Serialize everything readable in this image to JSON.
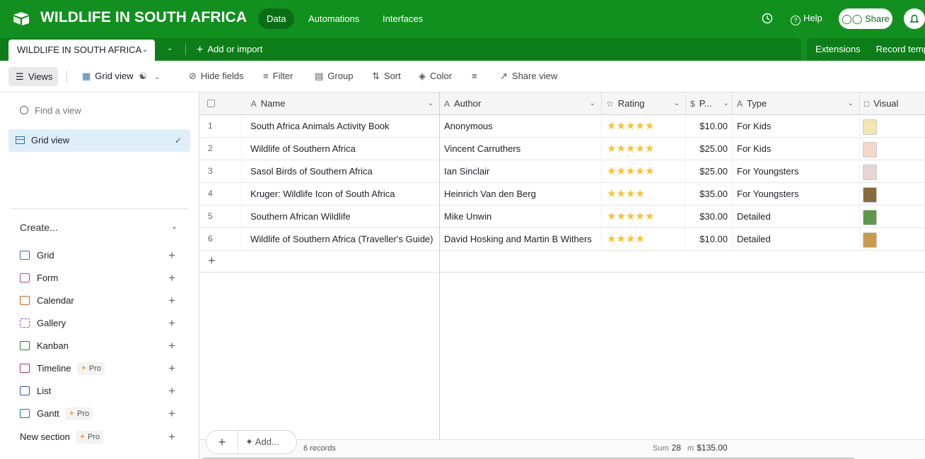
{
  "app": {
    "base_title": "WILDLIFE IN SOUTH AFRICA",
    "nav": [
      "Data",
      "Automations",
      "Interfaces"
    ],
    "help": "Help",
    "share": "Share",
    "brand_color": "#12901f"
  },
  "tabs": {
    "active": "WILDLIFE IN SOUTH AFRICA",
    "add_import": "Add or import",
    "extensions": "Extensions",
    "record_templates": "Record temp"
  },
  "toolbar": {
    "views": "Views",
    "grid_view": "Grid view",
    "hide_fields": "Hide fields",
    "filter": "Filter",
    "group": "Group",
    "sort": "Sort",
    "color": "Color",
    "share_view": "Share view"
  },
  "sidebar": {
    "find_placeholder": "Find a view",
    "active_view": "Grid view",
    "create_title": "Create...",
    "create_items": [
      {
        "label": "Grid",
        "icon": "grid-icon",
        "pro": false
      },
      {
        "label": "Form",
        "icon": "form-icon",
        "pro": false
      },
      {
        "label": "Calendar",
        "icon": "calendar-icon",
        "pro": false
      },
      {
        "label": "Gallery",
        "icon": "gallery-icon",
        "pro": false
      },
      {
        "label": "Kanban",
        "icon": "kanban-icon",
        "pro": false
      },
      {
        "label": "Timeline",
        "icon": "timeline-icon",
        "pro": true
      },
      {
        "label": "List",
        "icon": "list-icon",
        "pro": false
      },
      {
        "label": "Gantt",
        "icon": "gantt-icon",
        "pro": true
      }
    ],
    "new_section": "New section",
    "pro_label": "Pro"
  },
  "grid": {
    "columns": {
      "name": "Name",
      "author": "Author",
      "rating": "Rating",
      "price": "P...",
      "type": "Type",
      "visual": "Visual"
    },
    "rows": [
      {
        "num": "1",
        "name": "South Africa Animals Activity Book",
        "author": "Anonymous",
        "rating": 5,
        "price": "$10.00",
        "type": "For Kids",
        "thumb": "#f1e7b0"
      },
      {
        "num": "2",
        "name": "Wildlife of Southern Africa",
        "author": "Vincent Carruthers",
        "rating": 5,
        "price": "$25.00",
        "type": "For Kids",
        "thumb": "#f4d8c8"
      },
      {
        "num": "3",
        "name": "Sasol Birds of Southern Africa",
        "author": "Ian Sinclair",
        "rating": 5,
        "price": "$25.00",
        "type": "For Youngsters",
        "thumb": "#e8d4d4"
      },
      {
        "num": "4",
        "name": "Kruger: Wildlife Icon of South Africa",
        "author": "Heinrich Van den Berg",
        "rating": 4,
        "price": "$35.00",
        "type": "For Youngsters",
        "thumb": "#8a6a3a"
      },
      {
        "num": "5",
        "name": "Southern African Wildlife",
        "author": "Mike Unwin",
        "rating": 5,
        "price": "$30.00",
        "type": "Detailed",
        "thumb": "#5a9a4a"
      },
      {
        "num": "6",
        "name": "Wildlife of Southern Africa (Traveller's Guide)",
        "author": "David Hosking and Martin B Withers",
        "rating": 4,
        "price": "$10.00",
        "type": "Detailed",
        "thumb": "#c89a4a"
      }
    ],
    "add_label": "Add...",
    "records": "6 records",
    "sum_label": "Sum",
    "sum_rating": "28",
    "sum_price_prefix": "m",
    "sum_price": "$135.00"
  }
}
